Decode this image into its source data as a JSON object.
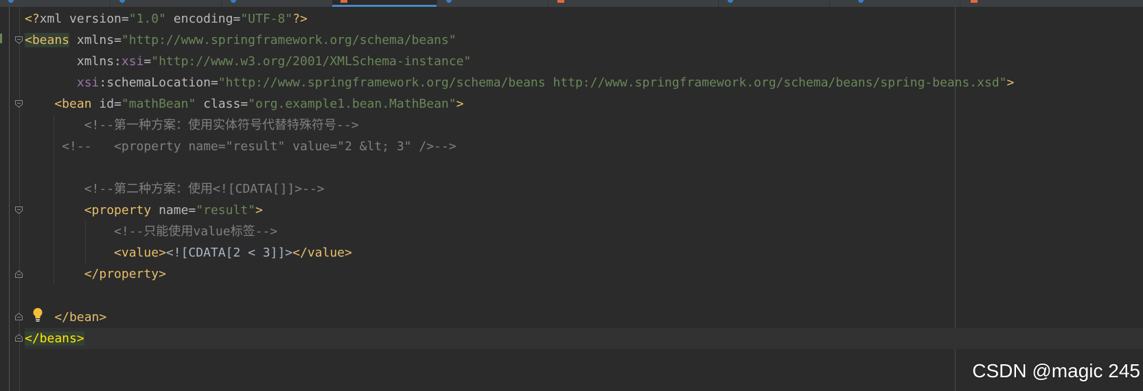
{
  "editor": {
    "lines": {
      "l1": {
        "p1": "<?",
        "p2": "xml version",
        "p3": "=",
        "p4": "\"1.0\"",
        "p5": " encoding",
        "p6": "=",
        "p7": "\"UTF-8\"",
        "p8": "?>"
      },
      "l2": {
        "p1": "<beans",
        "p2": " xmlns",
        "p3": "=",
        "p4": "\"http://www.springframework.org/schema/beans\""
      },
      "l3": {
        "p1": "       xmlns",
        "p2": ":",
        "p3": "xsi",
        "p4": "=",
        "p5": "\"http://www.w3.org/2001/XMLSchema-instance\""
      },
      "l4": {
        "p1": "       ",
        "p2": "xsi",
        "p3": ":schemaLocation",
        "p4": "=",
        "p5": "\"http://www.springframework.org/schema/beans http://www.springframework.org/schema/beans/spring-beans.xsd\"",
        "p6": ">"
      },
      "l5": {
        "p1": "    <bean",
        "p2": " id",
        "p3": "=",
        "p4": "\"mathBean\"",
        "p5": " class",
        "p6": "=",
        "p7": "\"org.example1.bean.MathBean\"",
        "p8": ">"
      },
      "l6": "        <!--第一种方案：使用实体符号代替特殊符号-->",
      "l7": "     <!--   <property name=\"result\" value=\"2 &lt; 3\" />-->",
      "l8": "        <!--第二种方案：使用<![CDATA[]]>-->",
      "l9": {
        "p1": "        <property",
        "p2": " name",
        "p3": "=",
        "p4": "\"result\"",
        "p5": ">"
      },
      "l10": "            <!--只能使用value标签-->",
      "l11": {
        "p1": "            <value>",
        "p2": "<![CDATA[2 < 3]]>",
        "p3": "</value>"
      },
      "l12": "        </property>",
      "l13": "    </bean>",
      "l14": "</beans>"
    }
  },
  "watermark": "CSDN @magic 245",
  "icons": {
    "bulb": "lightbulb-icon",
    "fold": "fold-marker-icon"
  },
  "colors": {
    "background": "#2b2b2b",
    "tag": "#e8bf6a",
    "string": "#6a8759",
    "namespace": "#9876aa",
    "comment": "#808080",
    "text": "#a9b7c6"
  }
}
